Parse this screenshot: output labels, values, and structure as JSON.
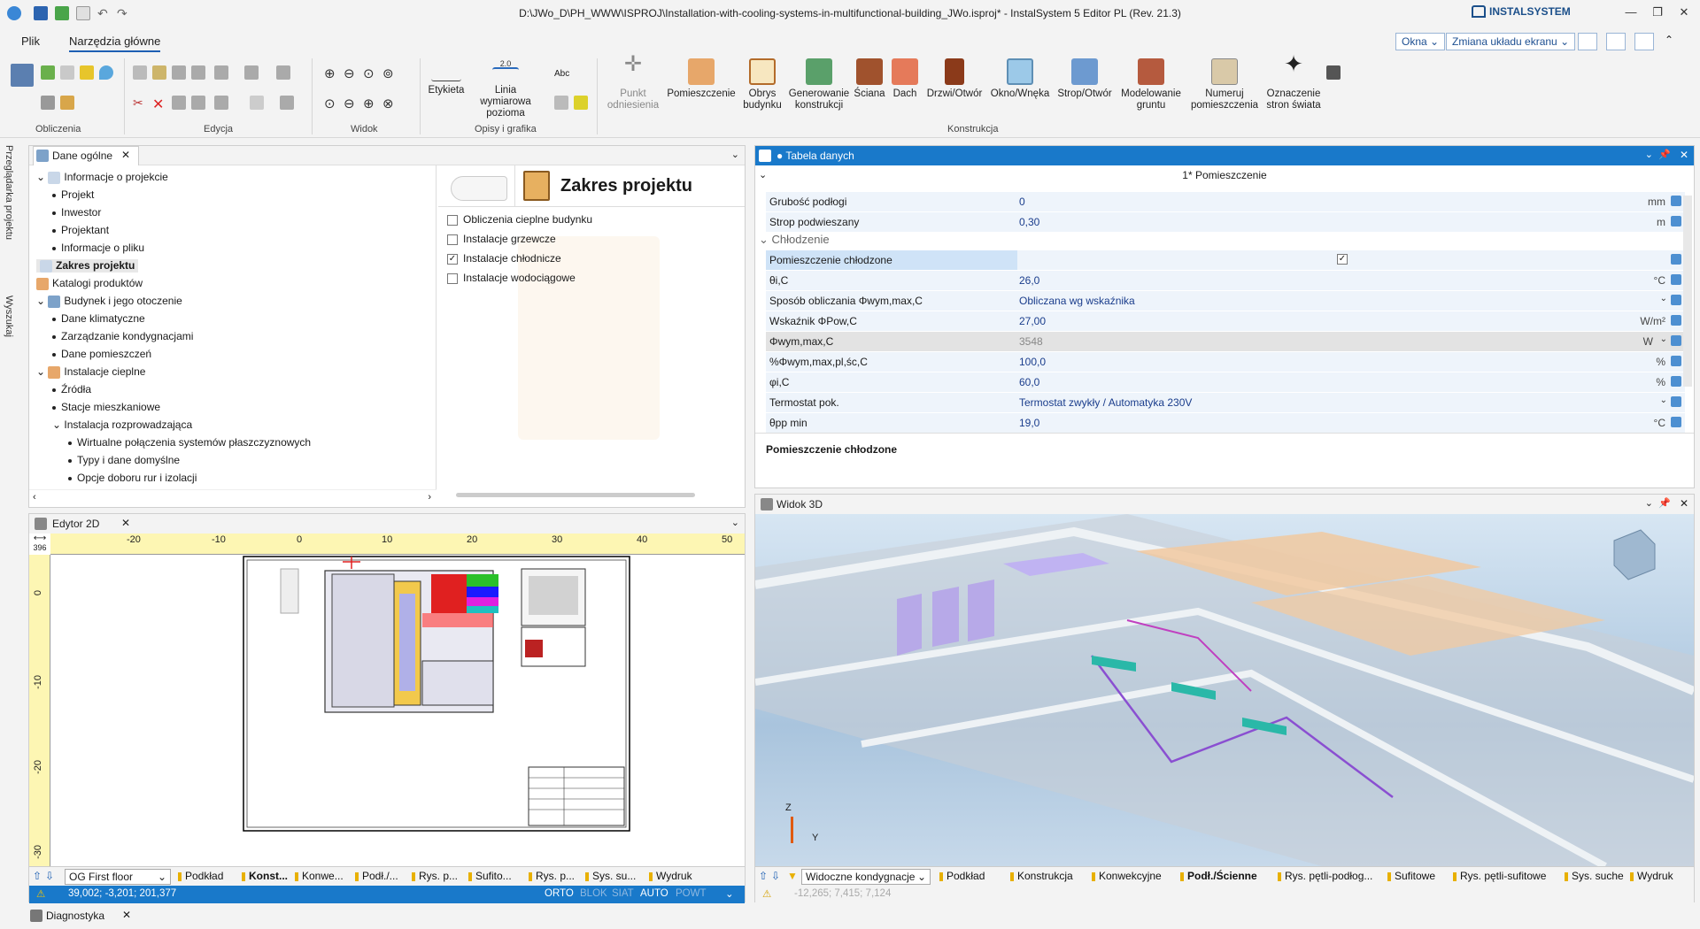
{
  "window": {
    "title": "D:\\JWo_D\\PH_WWW\\ISPROJ\\Installation-with-cooling-systems-in-multifunctional-building_JWo.isproj* - InstalSystem 5 Editor PL (Rev. 21.3)",
    "brand": "INSTALSYSTEM"
  },
  "menu": {
    "tabs": [
      "Plik",
      "Narzędzia główne"
    ],
    "okna": "Okna",
    "layout": "Zmiana układu ekranu"
  },
  "ribbon": {
    "groups": [
      "Obliczenia",
      "Edycja",
      "Widok",
      "Opisy i grafika",
      "Konstrukcja"
    ],
    "etykieta": "Etykieta",
    "linia": "Linia wymiarowa",
    "pozioma": "pozioma",
    "abc": "Abc",
    "dim_value": "2.0",
    "punkt": "Punkt",
    "odniesienia": "odniesienia",
    "buttons": [
      {
        "l1": "Pomieszczenie",
        "l2": ""
      },
      {
        "l1": "Obrys",
        "l2": "budynku"
      },
      {
        "l1": "Generowanie",
        "l2": "konstrukcji"
      },
      {
        "l1": "Ściana",
        "l2": ""
      },
      {
        "l1": "Dach",
        "l2": ""
      },
      {
        "l1": "Drzwi/Otwór",
        "l2": ""
      },
      {
        "l1": "Okno/Wnęka",
        "l2": ""
      },
      {
        "l1": "Strop/Otwór",
        "l2": ""
      },
      {
        "l1": "Modelowanie",
        "l2": "gruntu"
      },
      {
        "l1": "Numeruj",
        "l2": "pomieszczenia"
      },
      {
        "l1": "Oznaczenie",
        "l2": "stron świata"
      }
    ]
  },
  "side_tabs": {
    "a": "Przeglądarka projektu",
    "b": "Wyszukaj"
  },
  "general": {
    "title": "Dane ogólne",
    "tree": [
      {
        "label": "Informacje o projekcie",
        "level": 0,
        "exp": "open"
      },
      {
        "label": "Projekt",
        "level": 1
      },
      {
        "label": "Inwestor",
        "level": 1
      },
      {
        "label": "Projektant",
        "level": 1
      },
      {
        "label": "Informacje o pliku",
        "level": 1
      },
      {
        "label": "Zakres projektu",
        "level": 0,
        "selected": true
      },
      {
        "label": "Katalogi produktów",
        "level": 0
      },
      {
        "label": "Budynek i jego otoczenie",
        "level": 0,
        "exp": "open"
      },
      {
        "label": "Dane klimatyczne",
        "level": 1
      },
      {
        "label": "Zarządzanie kondygnacjami",
        "level": 1
      },
      {
        "label": "Dane pomieszczeń",
        "level": 1
      },
      {
        "label": "Instalacje cieplne",
        "level": 0,
        "exp": "open"
      },
      {
        "label": "Źródła",
        "level": 1
      },
      {
        "label": "Stacje mieszkaniowe",
        "level": 1
      },
      {
        "label": "Instalacja rozprowadzająca",
        "level": 1,
        "exp": "open"
      },
      {
        "label": "Wirtualne połączenia systemów płaszczyznowych",
        "level": 2
      },
      {
        "label": "Typy i dane domyślne",
        "level": 2
      },
      {
        "label": "Opcje doboru rur i izolacji",
        "level": 2
      }
    ],
    "scope_title": "Zakres projektu",
    "scope_items": [
      {
        "label": "Obliczenia cieplne budynku",
        "checked": false
      },
      {
        "label": "Instalacje grzewcze",
        "checked": false
      },
      {
        "label": "Instalacje chłodnicze",
        "checked": true
      },
      {
        "label": "Instalacje wodociągowe",
        "checked": false
      }
    ]
  },
  "table": {
    "title": "● Tabela danych",
    "header": "1* Pomieszczenie",
    "rows": [
      {
        "label": "Grubość podłogi",
        "value": "0",
        "unit": "mm"
      },
      {
        "label": "Strop podwieszany",
        "value": "0,30",
        "unit": "m"
      }
    ],
    "section": "Chłodzenie",
    "rows2": [
      {
        "label": "Pomieszczenie chłodzone",
        "value": "",
        "unit": "",
        "check": true
      },
      {
        "label": "θi,C",
        "value": "26,0",
        "unit": "°C"
      },
      {
        "label": "Sposób obliczania Φwym,max,C",
        "value": "Obliczana wg wskaźnika",
        "unit": "",
        "dd": true
      },
      {
        "label": "Wskaźnik ΦPow,C",
        "value": "27,00",
        "unit": "W/m²"
      },
      {
        "label": "Φwym,max,C",
        "value": "3548",
        "unit": "W",
        "dd": true,
        "grey": true
      },
      {
        "label": "%Φwym,max,pl,śc,C",
        "value": "100,0",
        "unit": "%"
      },
      {
        "label": "φi,C",
        "value": "60,0",
        "unit": "%"
      },
      {
        "label": "Termostat pok.",
        "value": "Termostat zwykły / Automatyka 230V",
        "unit": "",
        "dd": true
      },
      {
        "label": "θpp min",
        "value": "19,0",
        "unit": "°C"
      }
    ],
    "description": "Pomieszczenie chłodzone"
  },
  "editor2d": {
    "title": "Edytor 2D",
    "ruler_h": [
      "-20",
      "-10",
      "0",
      "10",
      "20",
      "30",
      "40",
      "50"
    ],
    "ruler_v": [
      "0",
      "-10",
      "-20",
      "-30"
    ],
    "zoom_badge": "396",
    "floor": "OG First floor",
    "tabs": [
      "Podkład",
      "Konst...",
      "Konwe...",
      "Podł./...",
      "Rys. p...",
      "Sufito...",
      "Rys. p...",
      "Sys. su...",
      "Wydruk"
    ],
    "coords": "39,002; -3,201; 201,377",
    "status": [
      "ORTO",
      "BLOK",
      "SIAT",
      "AUTO",
      "POWT"
    ]
  },
  "view3d": {
    "title": "Widok 3D",
    "visible": "Widoczne kondygnacje",
    "tabs": [
      "Podkład",
      "Konstrukcja",
      "Konwekcyjne",
      "Podł./Ścienne",
      "Rys. pętli-podłog...",
      "Sufitowe",
      "Rys. pętli-sufitowe",
      "Sys. suche",
      "Wydruk"
    ],
    "coords": "-12,265; 7,415; 7,124",
    "axis": {
      "z": "Z",
      "y": "Y"
    }
  },
  "diag": {
    "title": "Diagnostyka"
  }
}
